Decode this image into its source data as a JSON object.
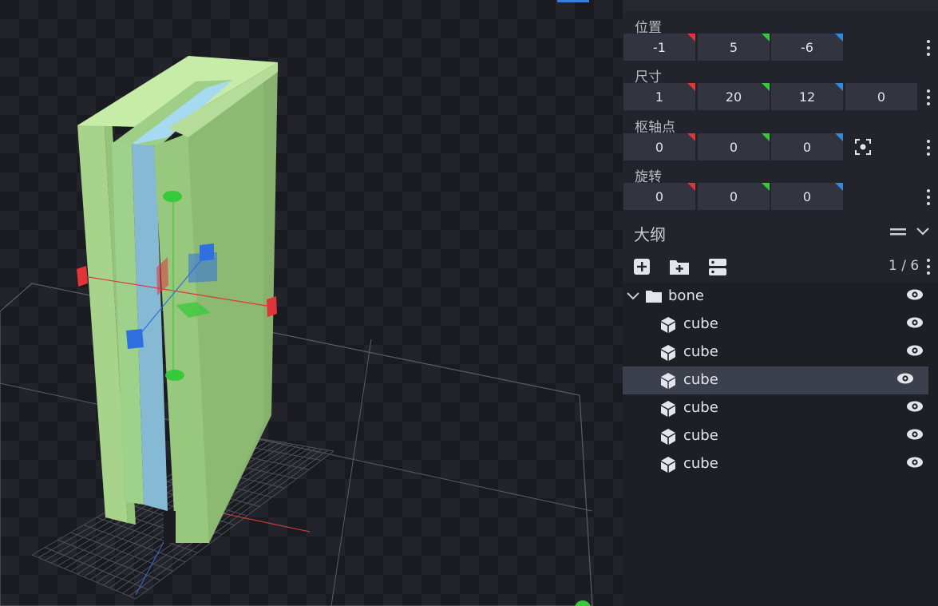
{
  "properties": {
    "position": {
      "label": "位置",
      "x": "-1",
      "y": "5",
      "z": "-6"
    },
    "size": {
      "label": "尺寸",
      "x": "1",
      "y": "20",
      "z": "12",
      "inflate": "0"
    },
    "pivot": {
      "label": "枢轴点",
      "x": "0",
      "y": "0",
      "z": "0"
    },
    "rotation": {
      "label": "旋转",
      "x": "0",
      "y": "0",
      "z": "0"
    }
  },
  "outliner": {
    "title": "大纲",
    "count": "1 / 6",
    "group": {
      "name": "bone"
    },
    "items": [
      {
        "name": "cube",
        "selected": false
      },
      {
        "name": "cube",
        "selected": false
      },
      {
        "name": "cube",
        "selected": true
      },
      {
        "name": "cube",
        "selected": false
      },
      {
        "name": "cube",
        "selected": false
      },
      {
        "name": "cube",
        "selected": false
      }
    ]
  },
  "colors": {
    "axis_x": "#e0333a",
    "axis_y": "#36c93a",
    "axis_z": "#2f6fe0",
    "selection": "#3c404c",
    "model_green": "#9bc97d",
    "model_blue": "#86c1dc"
  },
  "icons": [
    "add-cube-icon",
    "add-group-icon",
    "sort-icon",
    "folder-icon",
    "cube-icon",
    "eye-icon",
    "chevron-down-icon",
    "more-icon",
    "hamburger-icon",
    "pivot-center-icon"
  ]
}
